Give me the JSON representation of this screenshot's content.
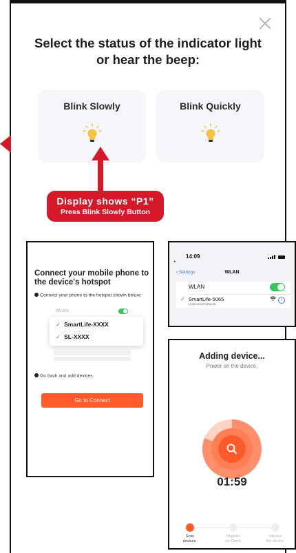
{
  "heading": "Select the status of the indicator light or hear the beep:",
  "cards": [
    {
      "label": "Blink Slowly"
    },
    {
      "label": "Blink Quickly"
    }
  ],
  "callout": {
    "line1": "Display shows “P1”",
    "line2": "Press Blink Slowly Button"
  },
  "colors": {
    "callout": "#d3192a",
    "accent": "#ff5a2a",
    "toggle_on": "#35c759",
    "ios_blue": "#3b7de0",
    "bulb": "#f6c343"
  },
  "hotspot": {
    "title": "Connect your mobile phone to the device's hotspot",
    "step1": "Connect your phone to the hotspot shown below:",
    "wlan_label": "WLAN",
    "networks": [
      "SmartLife-XXXX",
      "SL-XXXX"
    ],
    "step2": "Go back and add devices.",
    "button": "Go to Connect"
  },
  "wlan": {
    "time": "14:09",
    "back": "Settings",
    "header": "WLAN",
    "row_label": "WLAN",
    "network": "SmartLife-5065",
    "network_sub": "Unsecured Network"
  },
  "adding": {
    "title": "Adding device...",
    "subtitle": "Power on the device.",
    "timer": "01:59",
    "steps": [
      {
        "line1": "Scan",
        "line2": "devices."
      },
      {
        "line1": "Register",
        "line2": "on Cloud."
      },
      {
        "line1": "Initialize",
        "line2": "the device."
      }
    ]
  }
}
